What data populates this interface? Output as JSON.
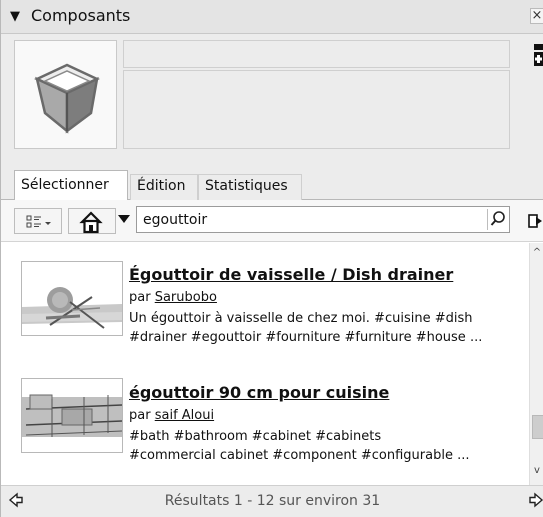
{
  "panel": {
    "title": "Composants",
    "close_label": "×"
  },
  "tabs": [
    {
      "label": "Sélectionner",
      "active": true
    },
    {
      "label": "Édition",
      "active": false
    },
    {
      "label": "Statistiques",
      "active": false
    }
  ],
  "search": {
    "value": "egouttoir"
  },
  "results": [
    {
      "title": "Égouttoir de vaisselle / Dish drainer",
      "by_prefix": "par",
      "author": "Sarubobo",
      "line1": "Un égouttoir à vaisselle de chez moi. #cuisine #dish",
      "line2": "#drainer #egouttoir #fourniture #furniture #house ..."
    },
    {
      "title": "égouttoir 90 cm pour cuisine",
      "by_prefix": "par",
      "author": "saif Aloui",
      "line1": "#bath #bathroom #cabinet #cabinets",
      "line2": "#commercial  cabinet #component #configurable ..."
    }
  ],
  "footer": {
    "status": "Résultats 1 - 12 sur environ 31"
  },
  "icons": {
    "collapse": "collapse-triangle-icon",
    "view_options": "view-options-icon",
    "home": "home-icon",
    "home_menu": "dropdown-arrow-icon",
    "search": "search-icon",
    "details": "details-arrow-icon",
    "prev": "previous-arrow-icon",
    "next": "next-arrow-icon",
    "preview": "component-cube-icon"
  }
}
